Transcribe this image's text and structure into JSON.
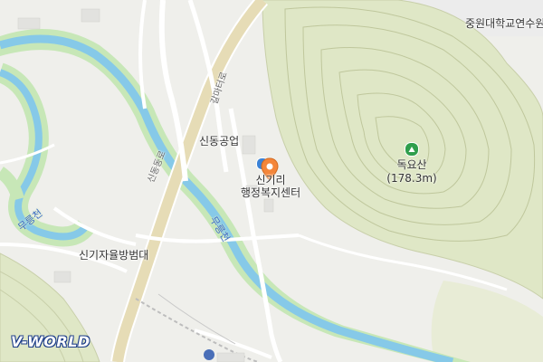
{
  "map": {
    "poi_top_right": "중원대학교연수원",
    "mountain_name": "독요산",
    "mountain_elevation": "(178.3m)",
    "place_industry": "신동공업",
    "office_line1": "신기리",
    "office_line2": "행정복지센터",
    "shelter": "신기자율방범대",
    "road_main": "신동동로",
    "road_secondary": "갈마터로",
    "river_left": "무릉천",
    "river_mid": "무릉천",
    "logo": "V-WORLD",
    "colors": {
      "river": "#86c9e8",
      "river_bank": "#c7e7b7",
      "hill": "#dfe7c6",
      "marker": "#f4863a"
    }
  }
}
